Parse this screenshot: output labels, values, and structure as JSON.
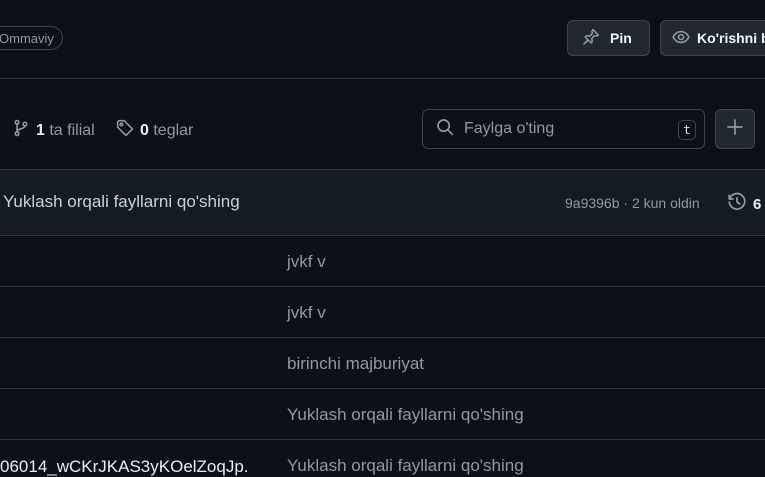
{
  "header": {
    "visibility_badge": "Ommaviy",
    "pin_label": "Pin",
    "watch_label": "Ko'rishni boshqarish"
  },
  "toolbar": {
    "branch_count": "1",
    "branch_label": "ta filial",
    "tag_count": "0",
    "tag_label": "teglar",
    "search_placeholder": "Faylga o'ting",
    "search_shortcut": "t"
  },
  "commit": {
    "message": "Yuklash orqali fayllarni qo'shing",
    "meta": "9a9396b · 2 kun oldin",
    "history_count": "6"
  },
  "files": [
    {
      "name": "",
      "commit": "jvkf v"
    },
    {
      "name": "",
      "commit": "jvkf v"
    },
    {
      "name": "",
      "commit": "birinchi majburiyat"
    },
    {
      "name": "",
      "commit": "Yuklash orqali fayllarni qo'shing"
    },
    {
      "name": "06014_wCKrJKAS3yKOelZoqJp...",
      "commit": "Yuklash orqali fayllarni qo'shing"
    }
  ],
  "icons": {
    "pin": "pin-icon",
    "watch": "eye-icon",
    "branch": "git-branch-icon",
    "tag": "tag-icon",
    "search": "search-icon",
    "add": "plus-icon",
    "history": "history-icon"
  }
}
